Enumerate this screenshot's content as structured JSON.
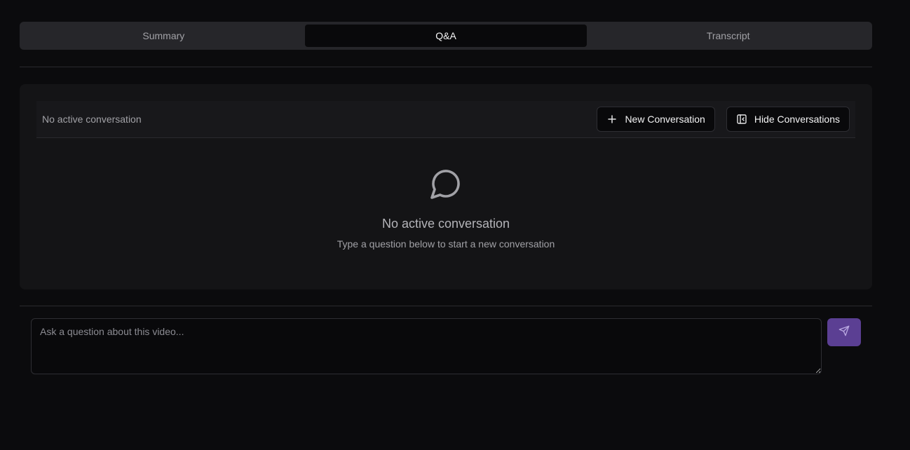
{
  "tabs": [
    {
      "label": "Summary",
      "active": false
    },
    {
      "label": "Q&A",
      "active": true
    },
    {
      "label": "Transcript",
      "active": false
    }
  ],
  "conversation_header": {
    "status": "No active conversation",
    "new_button": {
      "label": "New Conversation",
      "icon": "plus-icon"
    },
    "hide_button": {
      "label": "Hide Conversations",
      "icon": "panel-left-close-icon"
    }
  },
  "empty_state": {
    "icon": "message-circle-icon",
    "title": "No active conversation",
    "subtitle": "Type a question below to start a new conversation"
  },
  "composer": {
    "placeholder": "Ask a question about this video...",
    "value": "",
    "send_icon": "send-icon"
  },
  "colors": {
    "background": "#0b0b0d",
    "accent": "#5b3f93"
  }
}
